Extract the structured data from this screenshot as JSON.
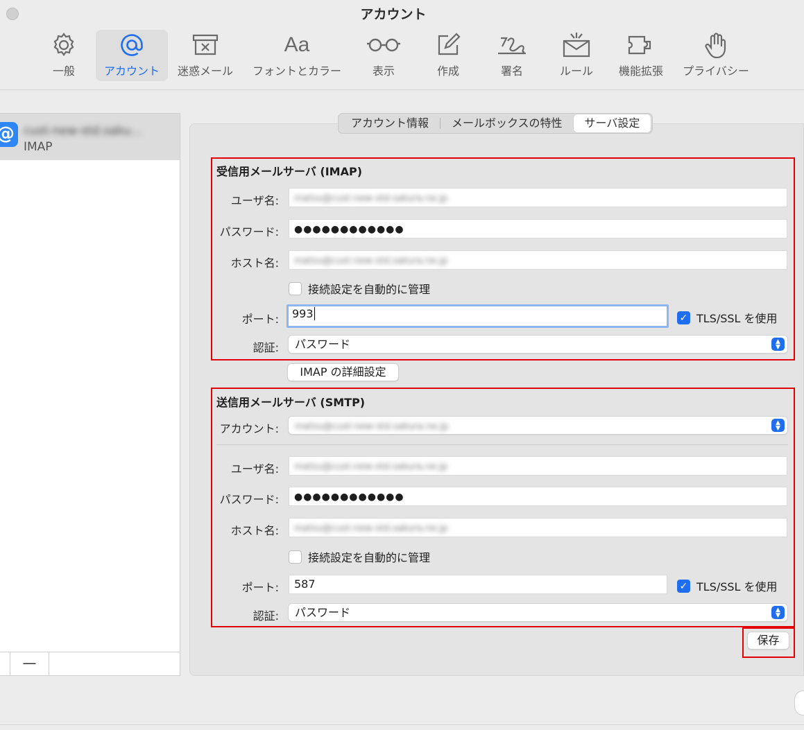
{
  "window": {
    "title": "アカウント"
  },
  "toolbar": {
    "items": [
      {
        "label": "一般",
        "icon": "gear-icon"
      },
      {
        "label": "アカウント",
        "icon": "at-icon"
      },
      {
        "label": "迷惑メール",
        "icon": "junk-tray-icon"
      },
      {
        "label": "フォントとカラー",
        "icon": "font-icon"
      },
      {
        "label": "表示",
        "icon": "glasses-icon"
      },
      {
        "label": "作成",
        "icon": "compose-icon"
      },
      {
        "label": "署名",
        "icon": "signature-icon"
      },
      {
        "label": "ルール",
        "icon": "rules-envelope-icon"
      },
      {
        "label": "機能拡張",
        "icon": "puzzle-icon"
      },
      {
        "label": "プライバシー",
        "icon": "hand-icon"
      }
    ],
    "active": "アカウント"
  },
  "sidebar": {
    "account": {
      "name": "cust-new-std.saku...",
      "type": "IMAP"
    },
    "add_label": "",
    "remove_label": "—"
  },
  "tabs": {
    "info": "アカウント情報",
    "mailbox": "メールボックスの特性",
    "server": "サーバ設定"
  },
  "incoming": {
    "title": "受信用メールサーバ (IMAP)",
    "username_label": "ユーザ名:",
    "username": "matsu@cust-new-std.sakura.ne.jp",
    "password_label": "パスワード:",
    "password": "●●●●●●●●●●●●",
    "host_label": "ホスト名:",
    "host": "matsu@cust-new-std.sakura.ne.jp",
    "auto_manage_label": "接続設定を自動的に管理",
    "port_label": "ポート:",
    "port": "993",
    "tls_label": "TLS/SSL を使用",
    "auth_label": "認証:",
    "auth": "パスワード",
    "advanced_button": "IMAP の詳細設定"
  },
  "outgoing": {
    "title": "送信用メールサーバ (SMTP)",
    "account_label": "アカウント:",
    "account": "matsu@cust-new-std.sakura.ne.jp",
    "username_label": "ユーザ名:",
    "username": "matsu@cust-new-std.sakura.ne.jp",
    "password_label": "パスワード:",
    "password": "●●●●●●●●●●●●",
    "host_label": "ホスト名:",
    "host": "matsu@cust-new-std.sakura.ne.jp",
    "auto_manage_label": "接続設定を自動的に管理",
    "port_label": "ポート:",
    "port": "587",
    "tls_label": "TLS/SSL を使用",
    "auth_label": "認証:",
    "auth": "パスワード"
  },
  "actions": {
    "save": "保存"
  },
  "colors": {
    "accent": "#1f6ef0",
    "highlight_box": "#e30000"
  }
}
